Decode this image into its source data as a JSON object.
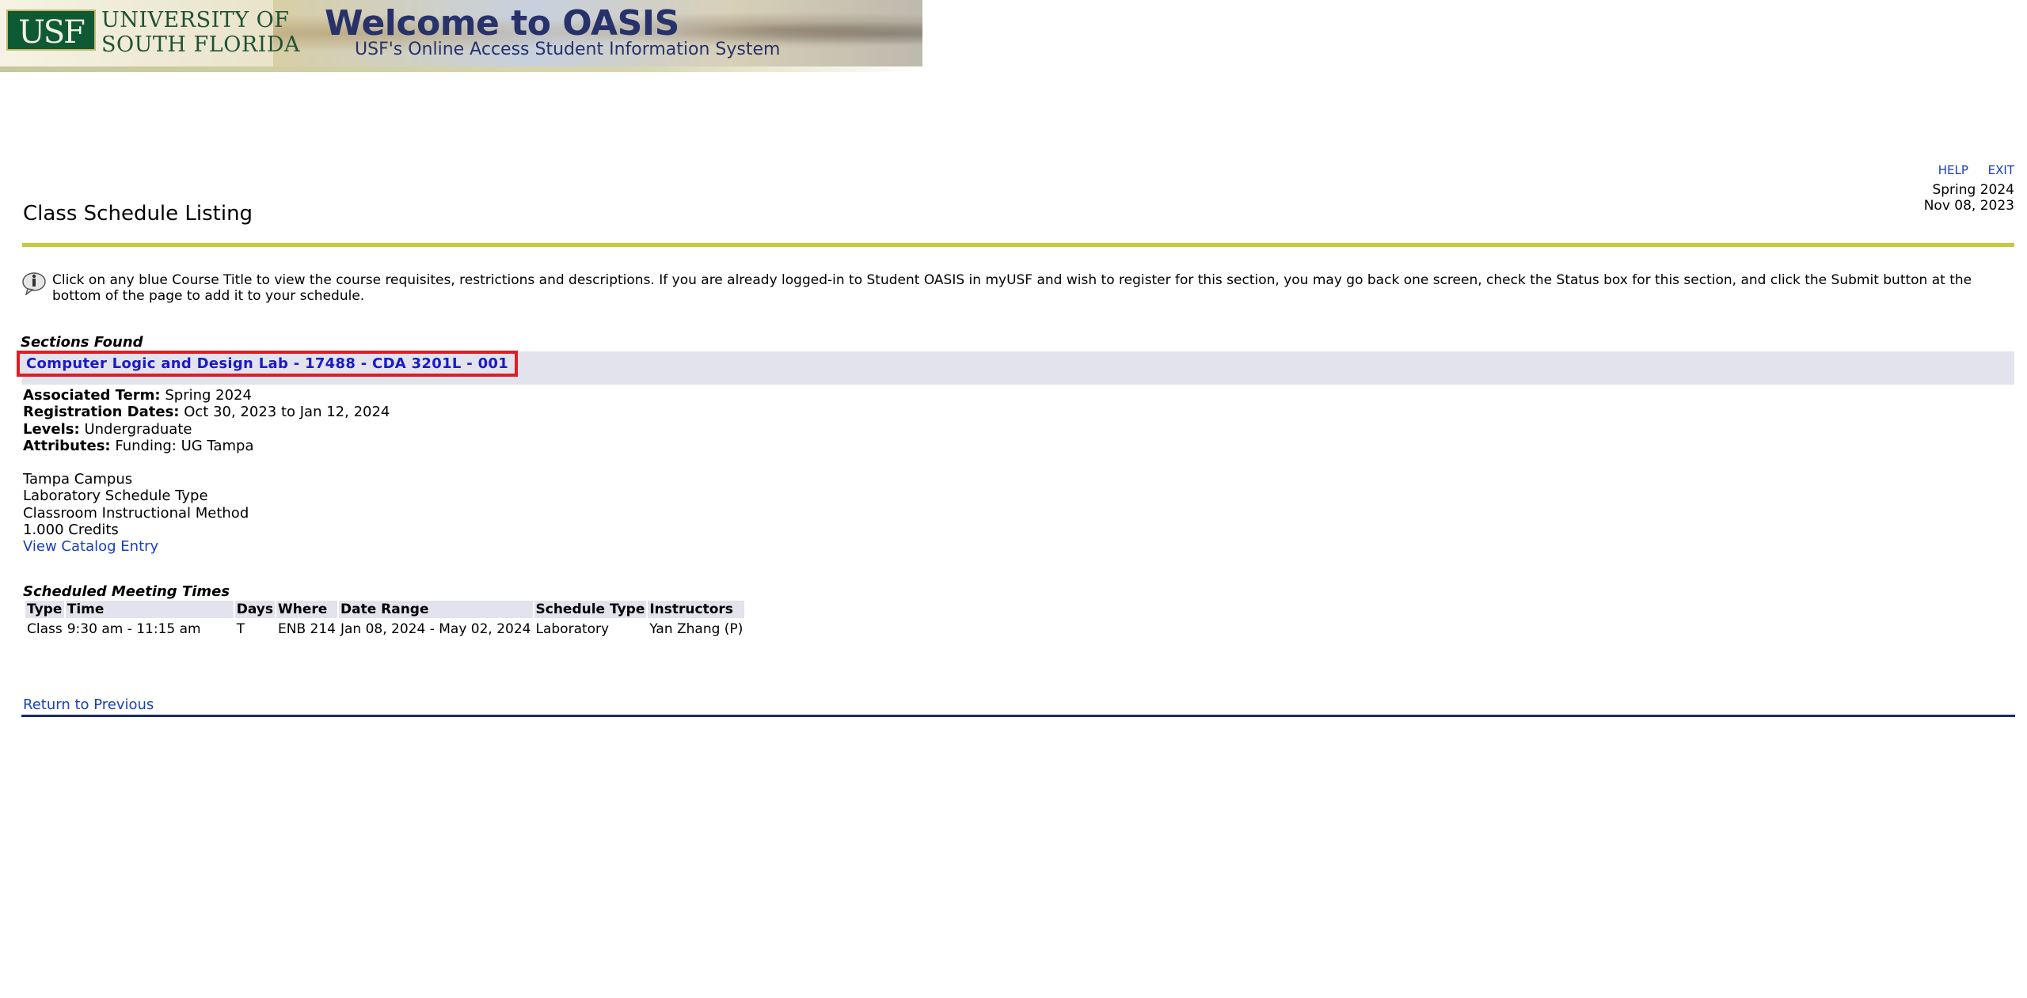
{
  "banner": {
    "logo_letters": "USF",
    "university_name_line1": "UNIVERSITY OF",
    "university_name_line2": "SOUTH FLORIDA",
    "welcome": "Welcome to OASIS",
    "subtitle": "USF's Online Access Student Information System"
  },
  "header": {
    "help_label": "HELP",
    "exit_label": "EXIT",
    "term": "Spring 2024",
    "date": "Nov 08, 2023",
    "title": "Class Schedule Listing"
  },
  "info": {
    "text": "Click on any blue Course Title to view the course requisites, restrictions and descriptions. If you are already logged-in to Student OASIS in myUSF and wish to register for this section, you may go back one screen, check the Status box for this section, and click the Submit button at the bottom of the page to add it to your schedule."
  },
  "section": {
    "heading": "Sections Found",
    "course_title": "Computer Logic and Design Lab - 17488 - CDA 3201L - 001",
    "associated_term_label": "Associated Term:",
    "associated_term": "Spring 2024",
    "registration_dates_label": "Registration Dates:",
    "registration_dates": "Oct 30, 2023 to Jan 12, 2024",
    "levels_label": "Levels:",
    "levels": "Undergraduate",
    "attributes_label": "Attributes:",
    "attributes": "Funding: UG Tampa",
    "campus": "Tampa Campus",
    "schedule_type": "Laboratory Schedule Type",
    "instructional_method": "Classroom Instructional Method",
    "credits": "1.000 Credits",
    "catalog_link": "View Catalog Entry"
  },
  "meeting_times": {
    "heading": "Scheduled Meeting Times",
    "columns": [
      "Type",
      "Time",
      "Days",
      "Where",
      "Date Range",
      "Schedule Type",
      "Instructors"
    ],
    "rows": [
      [
        "Class",
        "9:30 am - 11:15 am",
        "T",
        "ENB 214",
        "Jan 08, 2024 - May 02, 2024",
        "Laboratory",
        "Yan Zhang (P)"
      ]
    ]
  },
  "footer": {
    "return_label": "Return to Previous"
  },
  "colors": {
    "link": "#1a3fbf",
    "course_link": "#1a1ac8",
    "highlight_border": "#e01c24",
    "title_rule": "#c6c93a",
    "bottom_rule": "#1c2a66",
    "band": "#e3e3ee"
  }
}
